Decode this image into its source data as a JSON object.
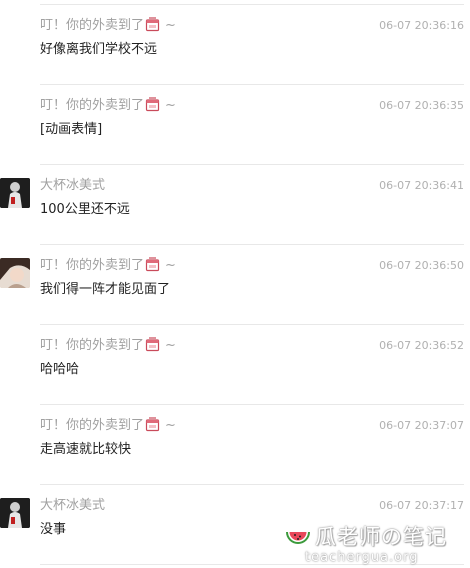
{
  "messages": [
    {
      "sender": "叮！你的外卖到了",
      "suffix": "~",
      "time": "06-07 20:36:16",
      "text": "好像离我们学校不远",
      "avatar": "none"
    },
    {
      "sender": "叮！你的外卖到了",
      "suffix": "~",
      "time": "06-07 20:36:35",
      "text": "[动画表情]",
      "avatar": "none"
    },
    {
      "sender": "大杯冰美式",
      "suffix": "",
      "time": "06-07 20:36:41",
      "text": "100公里还不远",
      "avatar": "dark"
    },
    {
      "sender": "叮！你的外卖到了",
      "suffix": "~",
      "time": "06-07 20:36:50",
      "text": "我们得一阵才能见面了",
      "avatar": "photo"
    },
    {
      "sender": "叮！你的外卖到了",
      "suffix": "~",
      "time": "06-07 20:36:52",
      "text": "哈哈哈",
      "avatar": "none"
    },
    {
      "sender": "叮！你的外卖到了",
      "suffix": "~",
      "time": "06-07 20:37:07",
      "text": "走高速就比较快",
      "avatar": "none"
    },
    {
      "sender": "大杯冰美式",
      "suffix": "",
      "time": "06-07 20:37:17",
      "text": "没事",
      "avatar": "dark"
    }
  ],
  "watermark": {
    "title": "瓜老师の笔记",
    "url": "teachergua.org"
  },
  "colors": {
    "sender": "#a0a0a0",
    "time": "#b0b0b0",
    "text": "#222222",
    "divider": "#e8e8e8"
  }
}
